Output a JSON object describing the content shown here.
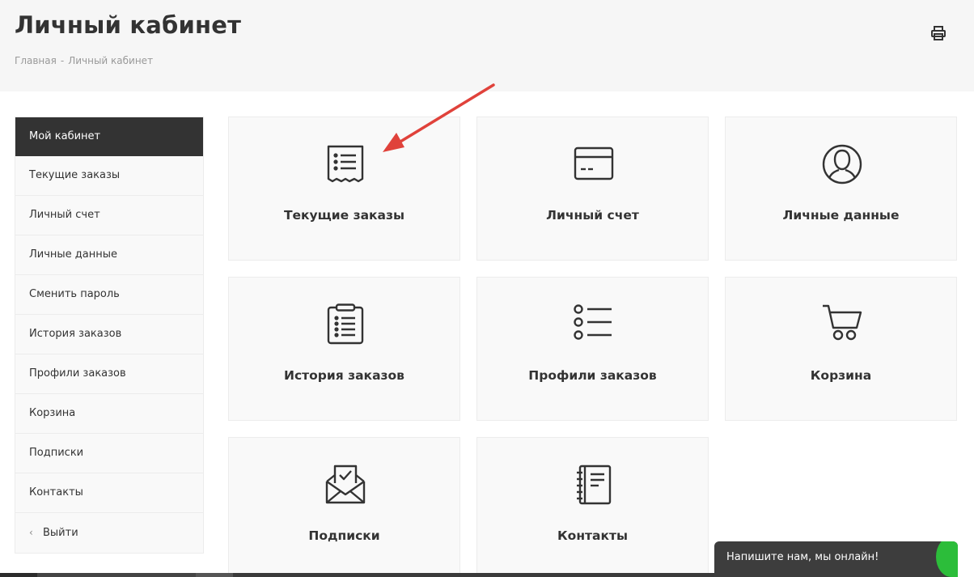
{
  "header": {
    "title": "Личный кабинет",
    "breadcrumb": [
      {
        "label": "Главная"
      },
      {
        "label": "Личный кабинет"
      }
    ],
    "breadcrumb_sep": "-"
  },
  "sidebar": {
    "items": [
      {
        "label": "Мой кабинет",
        "active": true
      },
      {
        "label": "Текущие заказы"
      },
      {
        "label": "Личный счет"
      },
      {
        "label": "Личные данные"
      },
      {
        "label": "Сменить пароль"
      },
      {
        "label": "История заказов"
      },
      {
        "label": "Профили заказов"
      },
      {
        "label": "Корзина"
      },
      {
        "label": "Подписки"
      },
      {
        "label": "Контакты"
      },
      {
        "label": "Выйти",
        "icon": "chevron-left-icon"
      }
    ]
  },
  "tiles": [
    {
      "label": "Текущие заказы",
      "icon": "receipt-icon"
    },
    {
      "label": "Личный счет",
      "icon": "credit-card-icon"
    },
    {
      "label": "Личные данные",
      "icon": "user-icon"
    },
    {
      "label": "История заказов",
      "icon": "clipboard-list-icon"
    },
    {
      "label": "Профили заказов",
      "icon": "list-icon"
    },
    {
      "label": "Корзина",
      "icon": "cart-icon"
    },
    {
      "label": "Подписки",
      "icon": "envelope-check-icon"
    },
    {
      "label": "Контакты",
      "icon": "notebook-icon"
    }
  ],
  "chat": {
    "label": "Напишите нам, мы онлайн!"
  },
  "colors": {
    "accent_dark": "#333333",
    "arrow": "#e0423b",
    "chat_green": "#2cbd3a"
  }
}
